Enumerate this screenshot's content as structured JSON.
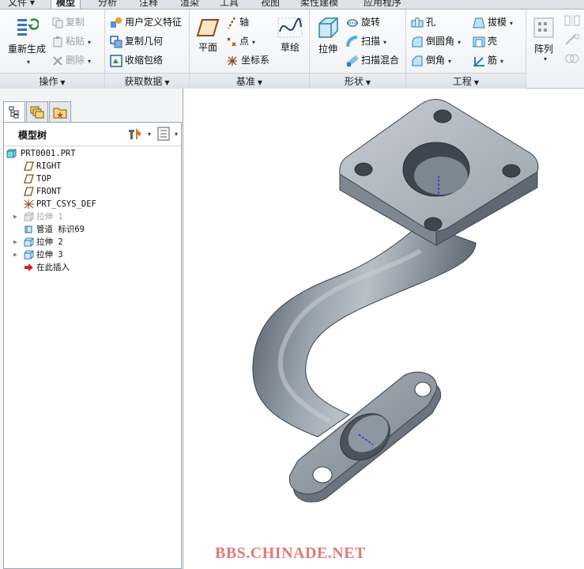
{
  "menu": {
    "tabs": [
      {
        "label": "文件 ▾"
      },
      {
        "label": "模型"
      },
      {
        "label": "分析"
      },
      {
        "label": "注释"
      },
      {
        "label": "渲染"
      },
      {
        "label": "工具"
      },
      {
        "label": "视图"
      },
      {
        "label": "柔性建模"
      },
      {
        "label": "应用程序"
      }
    ],
    "active_tab": "模型"
  },
  "ribbon": {
    "operations": {
      "label": "操作",
      "regenerate": "重新生成",
      "copy": "复制",
      "paste": "粘贴",
      "delete": "删除"
    },
    "get_data": {
      "label": "获取数据",
      "udf": "用户定义特征",
      "copy_geometry": "复制几何",
      "shrinkwrap": "收缩包络"
    },
    "datum": {
      "label": "基准",
      "plane": "平面",
      "axis": "轴",
      "point": "点",
      "csys": "坐标系",
      "sketch": "草绘"
    },
    "shapes": {
      "label": "形状",
      "extrude": "拉伸",
      "revolve": "旋转",
      "sweep": "扫描",
      "swept_blend": "扫描混合"
    },
    "engineering": {
      "label": "工程",
      "hole": "孔",
      "round": "倒圆角",
      "chamfer": "倒角",
      "draft": "拔模",
      "shell": "壳",
      "rib": "筋"
    },
    "pattern": {
      "label": "阵列"
    }
  },
  "model_tree": {
    "title": "模型树",
    "items": [
      {
        "label": "PRT0001.PRT",
        "icon": "part-icon"
      },
      {
        "label": "RIGHT",
        "icon": "datum-plane-icon"
      },
      {
        "label": "TOP",
        "icon": "datum-plane-icon"
      },
      {
        "label": "FRONT",
        "icon": "datum-plane-icon"
      },
      {
        "label": "PRT_CSYS_DEF",
        "icon": "csys-icon"
      },
      {
        "label": "拉伸 1",
        "icon": "extrude-icon",
        "suppressed": true
      },
      {
        "label": "管道 标识69",
        "icon": "pipe-icon"
      },
      {
        "label": "拉伸 2",
        "icon": "extrude-icon"
      },
      {
        "label": "拉伸 3",
        "icon": "extrude-icon"
      },
      {
        "label": "在此插入",
        "icon": "insert-arrow-icon"
      }
    ]
  },
  "watermark": "BBS.CHINADE.NET"
}
